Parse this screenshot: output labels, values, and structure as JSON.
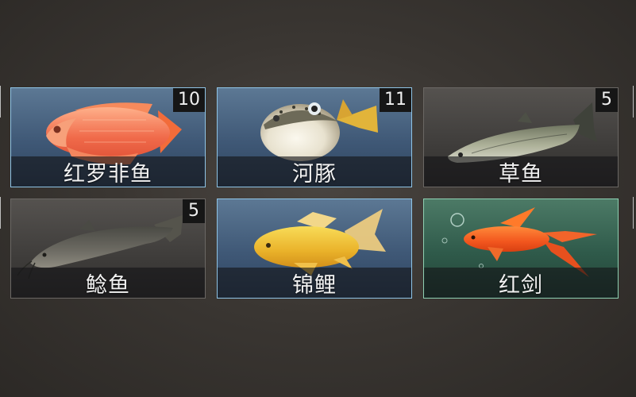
{
  "cards": [
    {
      "id": "red-tilapia",
      "name": "红罗非鱼",
      "count": "10",
      "theme": "blue",
      "icon": "red-tilapia-fish"
    },
    {
      "id": "pufferfish",
      "name": "河豚",
      "count": "11",
      "theme": "blue",
      "icon": "pufferfish"
    },
    {
      "id": "grass-carp",
      "name": "草鱼",
      "count": "5",
      "theme": "gray",
      "icon": "grass-carp-fish"
    },
    {
      "id": "catfish",
      "name": "鲶鱼",
      "count": "5",
      "theme": "gray",
      "icon": "catfish"
    },
    {
      "id": "goldfish",
      "name": "锦鲤",
      "count": "",
      "theme": "blue",
      "icon": "goldfish"
    },
    {
      "id": "swordtail",
      "name": "红剑",
      "count": "",
      "theme": "green",
      "icon": "red-swordtail-fish"
    }
  ]
}
